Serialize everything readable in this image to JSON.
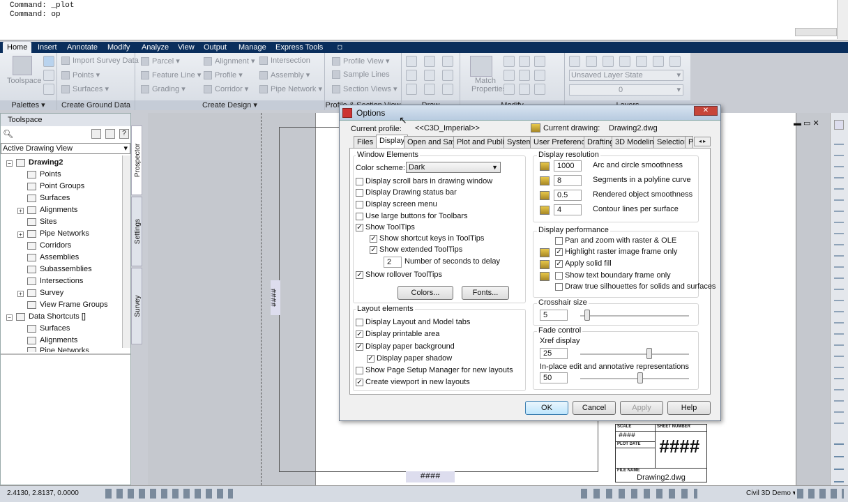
{
  "command_line": {
    "line1": "Command: _plot",
    "line2": "Command: op"
  },
  "ribbon": {
    "tabs": [
      "Home",
      "Insert",
      "Annotate",
      "Modify",
      "Analyze",
      "View",
      "Output",
      "Manage",
      "Express Tools"
    ],
    "toolspace_btn": "Toolspace",
    "palettes": "Palettes",
    "create_ground": "Create Ground Data",
    "create_design": "Create Design",
    "profile_section": "Profile & Section View",
    "draw": "Draw",
    "modify": "Modify",
    "layers": "Layers",
    "ground_items": [
      "Import Survey Data",
      "Points",
      "Surfaces"
    ],
    "design_items": [
      "Parcel",
      "Feature Line",
      "Grading",
      "Alignment",
      "Profile",
      "Corridor",
      "Intersection",
      "Assembly",
      "Pipe Network"
    ],
    "profile_items": [
      "Profile View",
      "Sample Lines",
      "Section Views"
    ],
    "match_properties": "Match Properties",
    "layer_state": "Unsaved Layer State",
    "layer_name": "0"
  },
  "toolspace": {
    "title": "Toolspace",
    "view": "Active Drawing View",
    "tabs": [
      "Prospector",
      "Settings",
      "Survey"
    ],
    "tree": [
      "Drawing2",
      "Points",
      "Point Groups",
      "Surfaces",
      "Alignments",
      "Sites",
      "Pipe Networks",
      "Corridors",
      "Assemblies",
      "Subassemblies",
      "Intersections",
      "Survey",
      "View Frame Groups",
      "Data Shortcuts []",
      "Surfaces",
      "Alignments",
      "Pipe Networks"
    ]
  },
  "drawing": {
    "marker": "####",
    "title_block": {
      "scale": "SCALE",
      "sheet_number": "SHEET NUMBER",
      "plot_date": "PLOT DATE",
      "file_name": "FILE NAME",
      "value": "####",
      "big": "####",
      "file": "Drawing2.dwg"
    }
  },
  "dialog": {
    "title": "Options",
    "current_profile_label": "Current profile:",
    "current_profile": "<<C3D_Imperial>>",
    "current_drawing_label": "Current drawing:",
    "current_drawing": "Drawing2.dwg",
    "tabs": [
      "Files",
      "Display",
      "Open and Save",
      "Plot and Publish",
      "System",
      "User Preferences",
      "Drafting",
      "3D Modeling",
      "Selection",
      "P"
    ],
    "window_elements": "Window Elements",
    "color_scheme_label": "Color scheme:",
    "color_scheme": "Dark",
    "we_checks": [
      {
        "label": "Display scroll bars in drawing window",
        "checked": false
      },
      {
        "label": "Display Drawing status bar",
        "checked": false
      },
      {
        "label": "Display screen menu",
        "checked": false
      },
      {
        "label": "Use large buttons for Toolbars",
        "checked": false
      },
      {
        "label": "Show ToolTips",
        "checked": true
      },
      {
        "label": "Show shortcut keys in ToolTips",
        "checked": true
      },
      {
        "label": "Show extended ToolTips",
        "checked": true
      }
    ],
    "seconds_value": "2",
    "seconds_label": "Number of seconds to delay",
    "rollover": "Show rollover ToolTips",
    "colors_btn": "Colors...",
    "fonts_btn": "Fonts...",
    "layout_elements": "Layout elements",
    "le_checks": [
      {
        "label": "Display Layout and Model tabs",
        "checked": false
      },
      {
        "label": "Display printable area",
        "checked": true
      },
      {
        "label": "Display paper background",
        "checked": true
      },
      {
        "label": "Display paper shadow",
        "checked": true
      },
      {
        "label": "Show Page Setup Manager for new layouts",
        "checked": false
      },
      {
        "label": "Create viewport in new layouts",
        "checked": true
      }
    ],
    "display_resolution": "Display resolution",
    "resolution": [
      {
        "value": "1000",
        "label": "Arc and circle smoothness"
      },
      {
        "value": "8",
        "label": "Segments in a polyline curve"
      },
      {
        "value": "0.5",
        "label": "Rendered object smoothness"
      },
      {
        "value": "4",
        "label": "Contour lines per surface"
      }
    ],
    "display_performance": "Display performance",
    "perf_checks": [
      {
        "label": "Pan and zoom with raster & OLE",
        "checked": false
      },
      {
        "label": "Highlight raster image frame only",
        "checked": true
      },
      {
        "label": "Apply solid fill",
        "checked": true
      },
      {
        "label": "Show text boundary frame only",
        "checked": false
      },
      {
        "label": "Draw true silhouettes for solids and surfaces",
        "checked": false
      }
    ],
    "crosshair_size": "Crosshair size",
    "crosshair_value": "5",
    "fade_control": "Fade control",
    "xref_label": "Xref display",
    "xref_value": "25",
    "inplace_label": "In-place edit and annotative representations",
    "inplace_value": "50",
    "ok": "OK",
    "cancel": "Cancel",
    "apply": "Apply",
    "help": "Help"
  },
  "status": {
    "coords": "2.4130, 2.8137, 0.0000",
    "workspace": "Civil 3D Demo"
  },
  "colors": {
    "ribbon_tabs": "#0a2e5c",
    "dialog_title": "#c8d8ea"
  }
}
